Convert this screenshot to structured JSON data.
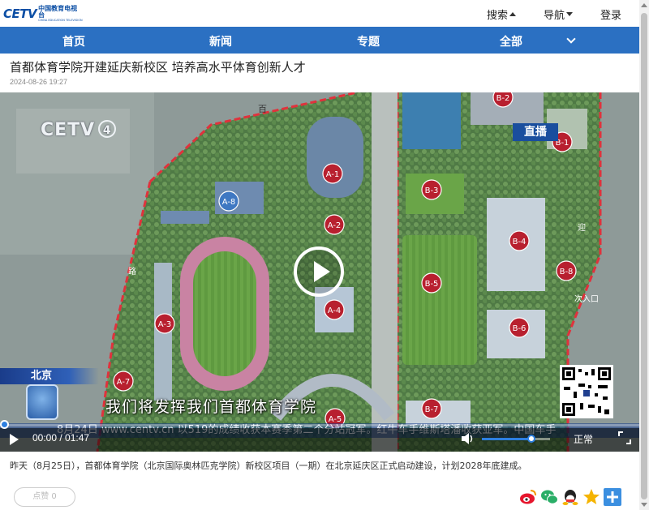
{
  "header": {
    "logo_mark": "CETV",
    "logo_cn": "中国教育电视台",
    "logo_en": "CHINA EDUCATION TELEVISION",
    "links": [
      {
        "label": "搜索",
        "caret": "up"
      },
      {
        "label": "导航",
        "caret": "down"
      },
      {
        "label": "登录",
        "caret": "none"
      }
    ]
  },
  "nav": {
    "items": [
      "首页",
      "新闻",
      "专题",
      "全部"
    ]
  },
  "article": {
    "title": "首都体育学院开建延庆新校区 培养高水平体育创新人才",
    "date": "2024-08-26 19:27",
    "summary": "昨天（8月25日），首都体育学院（北京国际奥林匹克学院）新校区项目（一期）在北京延庆区正式启动建设，计划2028年底建成。"
  },
  "video": {
    "channel_logo": "CETV",
    "channel_number": "4",
    "live_badge": "直播",
    "location": "北京",
    "subtitle": "我们将发挥我们首都体育学院",
    "ticker": "8月24日 www.centv.cn 以519的成绩收获本赛季第二个分站冠军。红牛车手维斯塔潘收获亚军。中国车手",
    "map_labels": [
      "A-1",
      "A-2",
      "A-3",
      "A-4",
      "A-5",
      "A-7",
      "A-8",
      "B-1",
      "B-2",
      "B-3",
      "B-4",
      "B-5",
      "B-6",
      "B-7",
      "B-8"
    ],
    "map_texts": {
      "road_top": "百",
      "road_right": "迎",
      "entry": "次入口",
      "road_left": "路"
    },
    "current_time": "00:00",
    "duration": "01:47",
    "progress": 0,
    "volume": 0.73,
    "quality": "正常"
  },
  "actions": {
    "like_label": "点赞 0",
    "share_icons": [
      "weibo-icon",
      "wechat-icon",
      "qq-icon",
      "qzone-icon",
      "more-share-icon"
    ]
  },
  "colors": {
    "nav_bg": "#2b70c2",
    "accent": "#2d7fe0",
    "marker_red": "#b8202f",
    "live_blue": "#1a4e9e"
  }
}
